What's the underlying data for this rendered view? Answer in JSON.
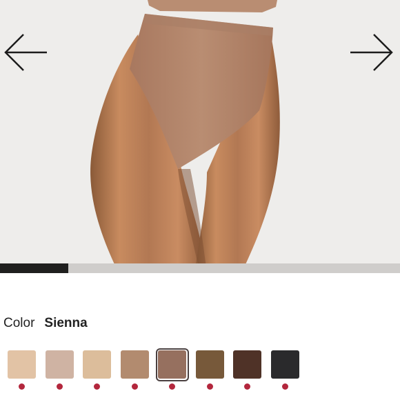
{
  "product_image": {
    "image_description_icon": "product-photo",
    "background_color": "#eeedeb"
  },
  "navigation": {
    "prev_icon": "arrow-left-icon",
    "next_icon": "arrow-right-icon"
  },
  "carousel": {
    "progress_fraction": 0.17,
    "fill_color": "#1f1f1e",
    "track_color": "#cfcdcb"
  },
  "color_selector": {
    "label": "Color",
    "selected_value": "Sienna",
    "swatches": [
      {
        "color": "#e2c3a5",
        "selected": false,
        "available_dot": "#b3273d"
      },
      {
        "color": "#cfb3a3",
        "selected": false,
        "available_dot": "#b3273d"
      },
      {
        "color": "#dcbd9b",
        "selected": false,
        "available_dot": "#b3273d"
      },
      {
        "color": "#b28b6f",
        "selected": false,
        "available_dot": "#b3273d"
      },
      {
        "color": "#96705f",
        "selected": true,
        "available_dot": "#b3273d"
      },
      {
        "color": "#77593a",
        "selected": false,
        "available_dot": "#b3273d"
      },
      {
        "color": "#4f3227",
        "selected": false,
        "available_dot": "#b3273d"
      },
      {
        "color": "#2a2a2c",
        "selected": false,
        "available_dot": "#b3273d"
      }
    ]
  }
}
